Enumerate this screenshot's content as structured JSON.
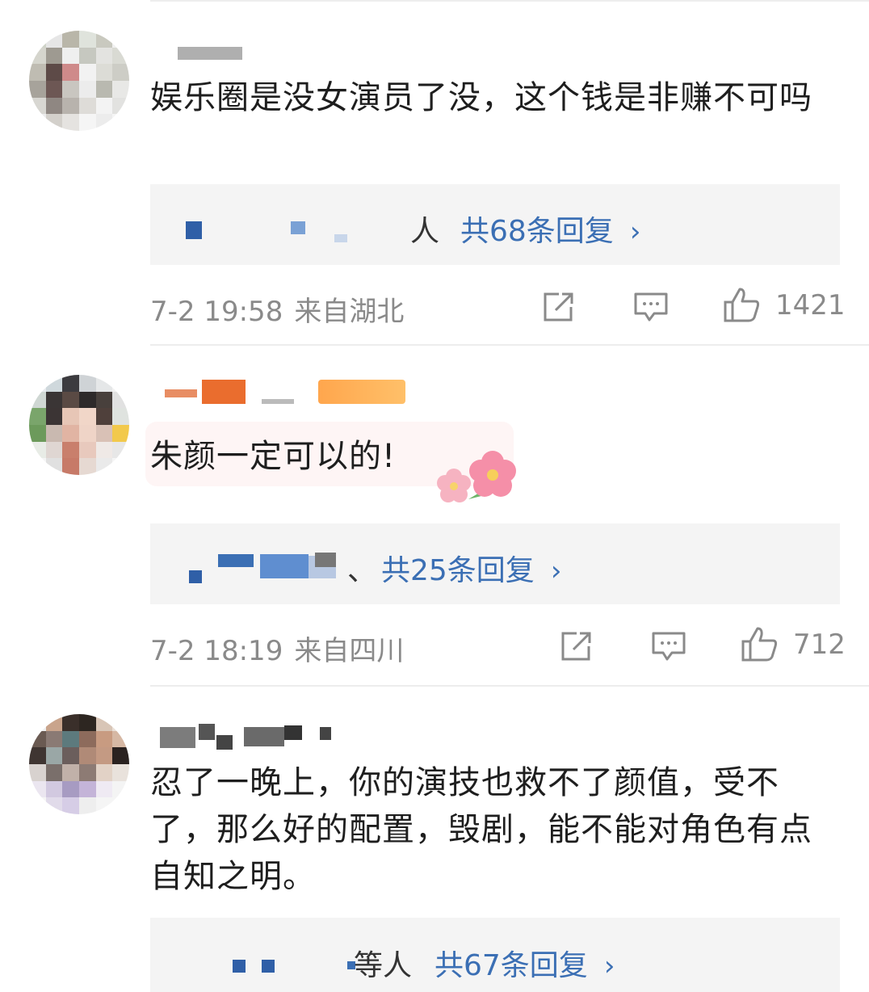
{
  "comments": [
    {
      "text": "娱乐圈是没女演员了没，这个钱是非赚不可吗",
      "reply_people_suffix": "人",
      "reply_count_label": "共68条回复",
      "timestamp": "7-2 19:58",
      "location": "来自湖北",
      "likes": "1421"
    },
    {
      "text": "朱颜一定可以的!",
      "reply_people_suffix": "、",
      "reply_count_label": "共25条回复",
      "timestamp": "7-2 18:19",
      "location": "来自四川",
      "likes": "712"
    },
    {
      "text": "忍了一晚上，你的演技也救不了颜值，受不了，那么好的配置，毁剧，能不能对角色有点自知之明。",
      "reply_people_suffix": "等人",
      "reply_count_label": "共67条回复"
    }
  ],
  "icons": {
    "share": "share-icon",
    "comment": "comment-icon",
    "like": "thumbs-up-icon",
    "expand": "chevron-right-icon"
  },
  "colors": {
    "link": "#3b6fb4",
    "meta": "#8a8a8a",
    "reply_bg": "#f4f4f4"
  }
}
